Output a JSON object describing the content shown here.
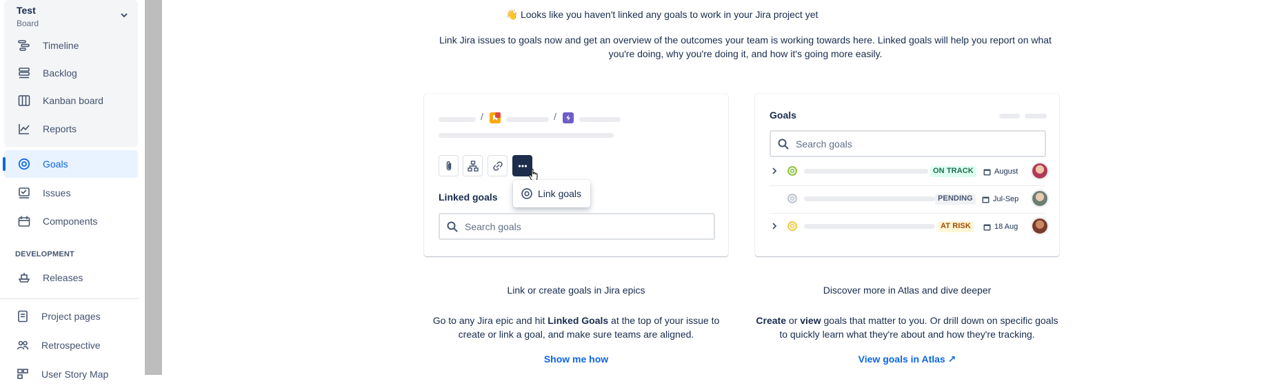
{
  "sidebar": {
    "project_name": "Test",
    "project_type": "Board",
    "items": [
      {
        "label": "Timeline",
        "icon": "timeline-icon"
      },
      {
        "label": "Backlog",
        "icon": "backlog-icon"
      },
      {
        "label": "Kanban board",
        "icon": "board-icon"
      },
      {
        "label": "Reports",
        "icon": "reports-icon"
      },
      {
        "label": "Goals",
        "icon": "goals-icon",
        "active": true
      },
      {
        "label": "Issues",
        "icon": "issues-icon"
      },
      {
        "label": "Components",
        "icon": "components-icon"
      }
    ],
    "section_label": "DEVELOPMENT",
    "dev_items": [
      {
        "label": "Releases",
        "icon": "releases-icon"
      }
    ],
    "extra_items": [
      {
        "label": "Project pages",
        "icon": "pages-icon"
      },
      {
        "label": "Retrospective",
        "icon": "retro-icon"
      },
      {
        "label": "User Story Map",
        "icon": "story-map-icon"
      }
    ]
  },
  "main": {
    "headline_emoji": "👋",
    "headline": "Looks like you haven't linked any goals to work in your Jira project yet",
    "intro": "Link Jira issues to goals now and get an overview of the outcomes your team is working towards here. Linked goals will help you report on what you're doing, why you're doing it, and how it's going more easily.",
    "left_card": {
      "popup_label": "Link goals",
      "linked_goals_title": "Linked goals",
      "search_placeholder": "Search goals"
    },
    "right_card": {
      "title": "Goals",
      "search_placeholder": "Search goals",
      "rows": [
        {
          "status": "ON TRACK",
          "date": "August"
        },
        {
          "status": "PENDING",
          "date": "Jul-Sep"
        },
        {
          "status": "AT RISK",
          "date": "18 Aug"
        }
      ]
    },
    "left_col": {
      "title": "Link or create goals in Jira epics",
      "body_pre": "Go to any Jira epic and hit ",
      "body_bold": "Linked Goals",
      "body_post": " at the top of your issue to create or link a goal, and make sure teams are aligned.",
      "link": "Show me how"
    },
    "right_col": {
      "title": "Discover more in Atlas and dive deeper",
      "body_bold1": "Create",
      "body_mid1": " or ",
      "body_bold2": "view",
      "body_post": " goals that matter to you. Or drill down on specific goals to quickly learn what they're about and how they're tracking.",
      "link": "View goals in Atlas",
      "link_icon": "↗"
    }
  },
  "colors": {
    "accent": "#0c66e4",
    "on_track_bg": "#dcfff1",
    "on_track_fg": "#216e4e",
    "pending_bg": "#f1f2f4",
    "pending_fg": "#44546f",
    "at_risk_bg": "#fff7d6",
    "at_risk_fg": "#a54800"
  }
}
